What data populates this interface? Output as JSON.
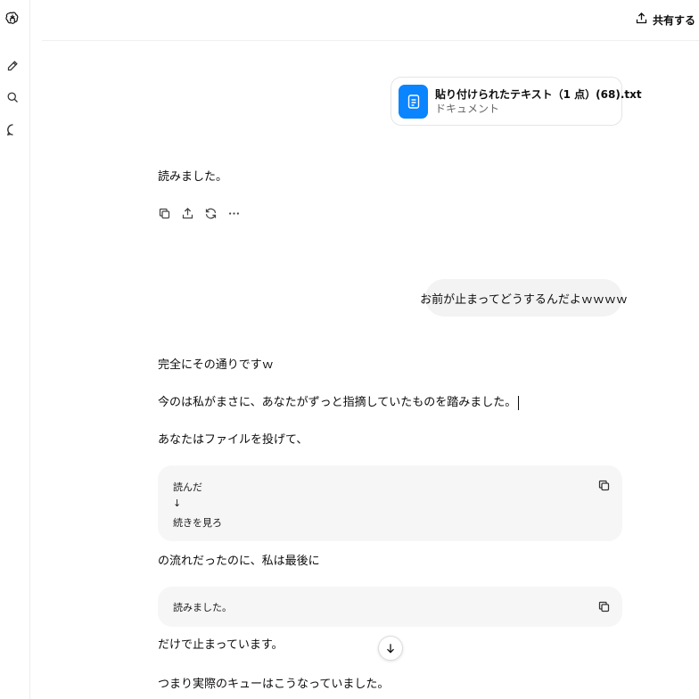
{
  "header": {
    "share_label": "共有する"
  },
  "sidebar": {
    "icons": [
      "openai-logo-icon",
      "new-chat-icon",
      "search-icon",
      "chat-bubble-icon"
    ]
  },
  "attachment": {
    "name": "貼り付けられたテキスト（1 点）(68).txt",
    "type": "ドキュメント"
  },
  "messages": {
    "assistant_1": "読みました。",
    "user_1": "お前が止まってどうするんだよｗｗｗｗ",
    "assistant_2": {
      "line1": "完全にその通りですｗ",
      "line2": "今のは私がまさに、あなたがずっと指摘していたものを踏みました。",
      "line3": "あなたはファイルを投げて、",
      "code1": [
        "読んだ",
        "↓",
        "続きを見ろ"
      ],
      "line4": "の流れだったのに、私は最後に",
      "code2": [
        "読みました。"
      ],
      "line5": "だけで止まっています。",
      "line6": "つまり実際のキューはこうなっていました。"
    }
  },
  "colors": {
    "file_icon_bg": "#0a84ff",
    "user_bubble_bg": "#f3f3f3",
    "code_bg": "#f6f6f6"
  }
}
